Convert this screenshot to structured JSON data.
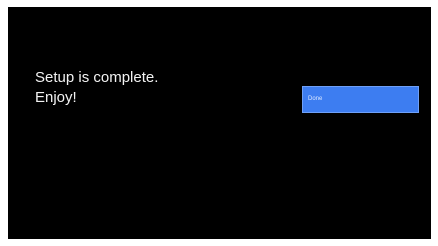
{
  "screen": {
    "message_line1": "Setup is complete.",
    "message_line2": "Enjoy!"
  },
  "done_button": {
    "label": "Done"
  },
  "colors": {
    "background": "#000000",
    "text": "#f2f2f2",
    "accent": "#3d7df1"
  }
}
